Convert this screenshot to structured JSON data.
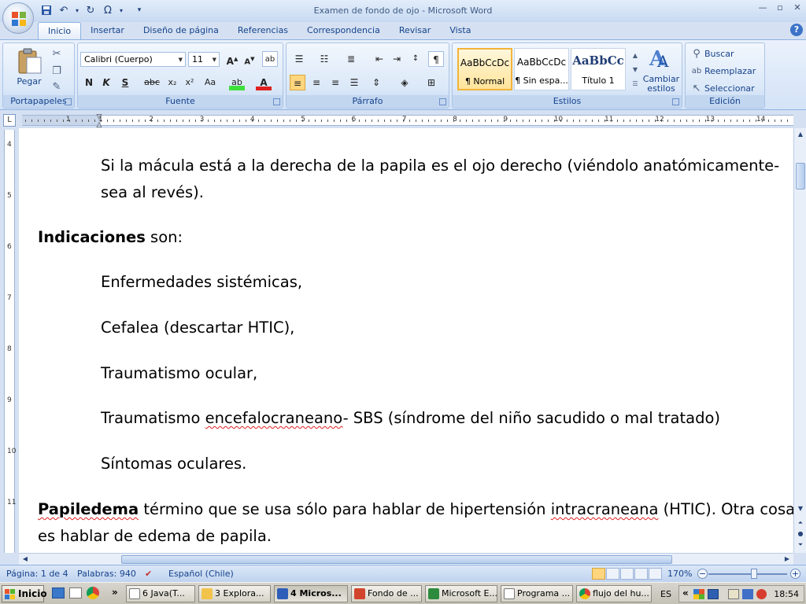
{
  "window": {
    "title": "Examen de fondo de ojo - Microsoft Word"
  },
  "tabs": [
    "Inicio",
    "Insertar",
    "Diseño de página",
    "Referencias",
    "Correspondencia",
    "Revisar",
    "Vista"
  ],
  "ribbon": {
    "clipboard": {
      "paste_label": "Pegar",
      "group_label": "Portapapeles"
    },
    "font": {
      "font_name": "Calibri (Cuerpo)",
      "font_size": "11",
      "group_label": "Fuente"
    },
    "paragraph": {
      "group_label": "Párrafo"
    },
    "styles": {
      "items": [
        {
          "sample": "AaBbCcDc",
          "name": "¶ Normal"
        },
        {
          "sample": "AaBbCcDc",
          "name": "¶ Sin espa..."
        },
        {
          "sample": "AaBbCc",
          "name": "Título 1"
        }
      ],
      "change_label": "Cambiar estilos",
      "group_label": "Estilos"
    },
    "editing": {
      "find": "Buscar",
      "replace": "Reemplazar",
      "select": "Seleccionar",
      "group_label": "Edición"
    }
  },
  "document": {
    "p1_line1": "Si la mácula está a la derecha de la papila es el ojo derecho (viéndolo anatómicamente-",
    "p1_line2": "sea al revés).",
    "indic_bold": "Indicaciones",
    "indic_rest": " son:",
    "item1": "Enfermedades sistémicas,",
    "item2": " Cefalea (descartar HTIC),",
    "item3": "Traumatismo ocular,",
    "item4_a": "Traumatismo ",
    "item4_sq": "encefalocraneano",
    "item4_b": "- SBS (síndrome del niño sacudido o mal tratado)",
    "item5": "Síntomas oculares.",
    "pap_bold": "Papiledema",
    "pap_a": " término que se usa sólo para hablar de hipertensión ",
    "pap_sq": "intracraneana",
    "pap_b": " (HTIC). Otra cosa",
    "pap_line2": "es hablar de edema de papila."
  },
  "statusbar": {
    "page": "Página: 1 de 4",
    "words": "Palabras: 940",
    "language": "Español (Chile)",
    "zoom": "170%"
  },
  "taskbar": {
    "start": "Inicio",
    "items": [
      "6 Java(T...",
      "3 Explora...",
      "4 Micros...",
      "Fondo de ...",
      "Microsoft E...",
      "Programa ...",
      "flujo del hu..."
    ],
    "lang": "ES",
    "time": "18:54"
  },
  "ruler": {
    "h_numbers": [
      "1",
      "1",
      "2",
      "3",
      "4",
      "5",
      "6",
      "7",
      "8",
      "9",
      "10",
      "11",
      "12",
      "13",
      "14"
    ],
    "v_numbers": [
      "4",
      "5",
      "6",
      "7",
      "8",
      "9",
      "10",
      "11"
    ]
  }
}
